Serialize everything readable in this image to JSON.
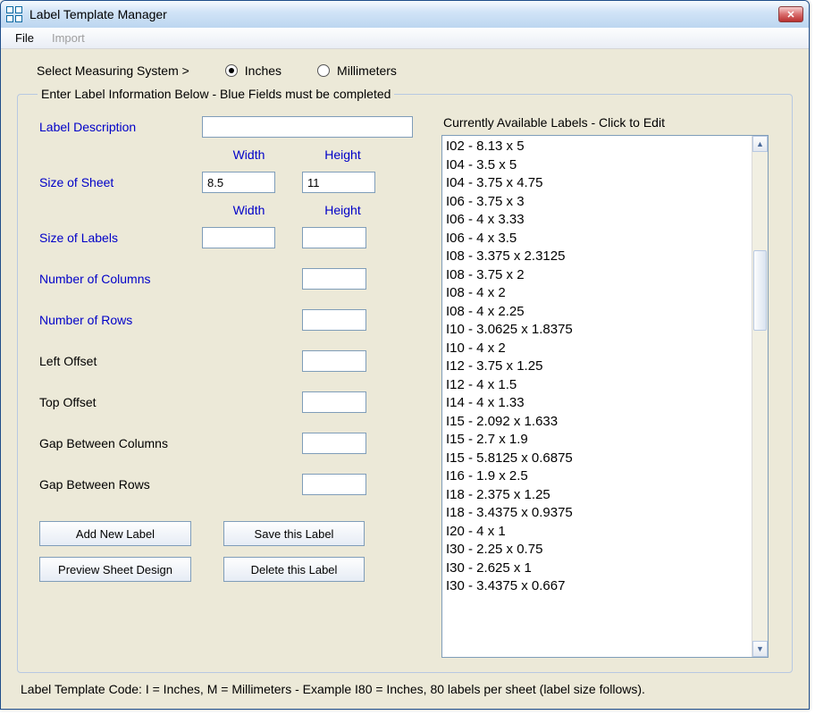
{
  "title": "Label Template Manager",
  "menu": {
    "file": "File",
    "import": "Import"
  },
  "measure": {
    "label": "Select Measuring System >",
    "inches": "Inches",
    "mm": "Millimeters",
    "selected": "inches"
  },
  "group_legend": "Enter Label Information Below - Blue Fields must be completed",
  "fields": {
    "label_description": "Label Description",
    "size_of_sheet": "Size of Sheet",
    "size_of_labels": "Size of Labels",
    "num_columns": "Number of Columns",
    "num_rows": "Number of Rows",
    "left_offset": "Left Offset",
    "top_offset": "Top Offset",
    "gap_cols": "Gap Between Columns",
    "gap_rows": "Gap Between Rows",
    "width": "Width",
    "height": "Height"
  },
  "values": {
    "sheet_width": "8.5",
    "sheet_height": "11",
    "label_width": "",
    "label_height": "",
    "label_description": "",
    "num_columns": "",
    "num_rows": "",
    "left_offset": "",
    "top_offset": "",
    "gap_cols": "",
    "gap_rows": ""
  },
  "buttons": {
    "add_new": "Add New Label",
    "save_this": "Save this Label",
    "preview": "Preview Sheet Design",
    "delete_this": "Delete this Label"
  },
  "list_title": "Currently Available Labels - Click to Edit",
  "labels": [
    "I02 - 8.13 x 5",
    "I04 - 3.5 x 5",
    "I04 - 3.75 x 4.75",
    "I06 - 3.75 x 3",
    "I06 - 4 x 3.33",
    "I06 - 4 x 3.5",
    "I08 - 3.375 x 2.3125",
    "I08 - 3.75 x 2",
    "I08 - 4 x 2",
    "I08 - 4 x 2.25",
    "I10 - 3.0625 x 1.8375",
    "I10 - 4 x 2",
    "I12 - 3.75 x 1.25",
    "I12 - 4 x 1.5",
    "I14 - 4 x 1.33",
    "I15 - 2.092 x 1.633",
    "I15 - 2.7 x 1.9",
    "I15 - 5.8125 x 0.6875",
    "I16 - 1.9 x 2.5",
    "I18 - 2.375 x 1.25",
    "I18 - 3.4375 x 0.9375",
    "I20 - 4 x 1",
    "I30 - 2.25 x 0.75",
    "I30 - 2.625 x 1",
    "I30 - 3.4375 x 0.667"
  ],
  "footer": "Label Template Code: I = Inches, M = Millimeters - Example I80 = Inches, 80 labels per sheet (label size follows)."
}
